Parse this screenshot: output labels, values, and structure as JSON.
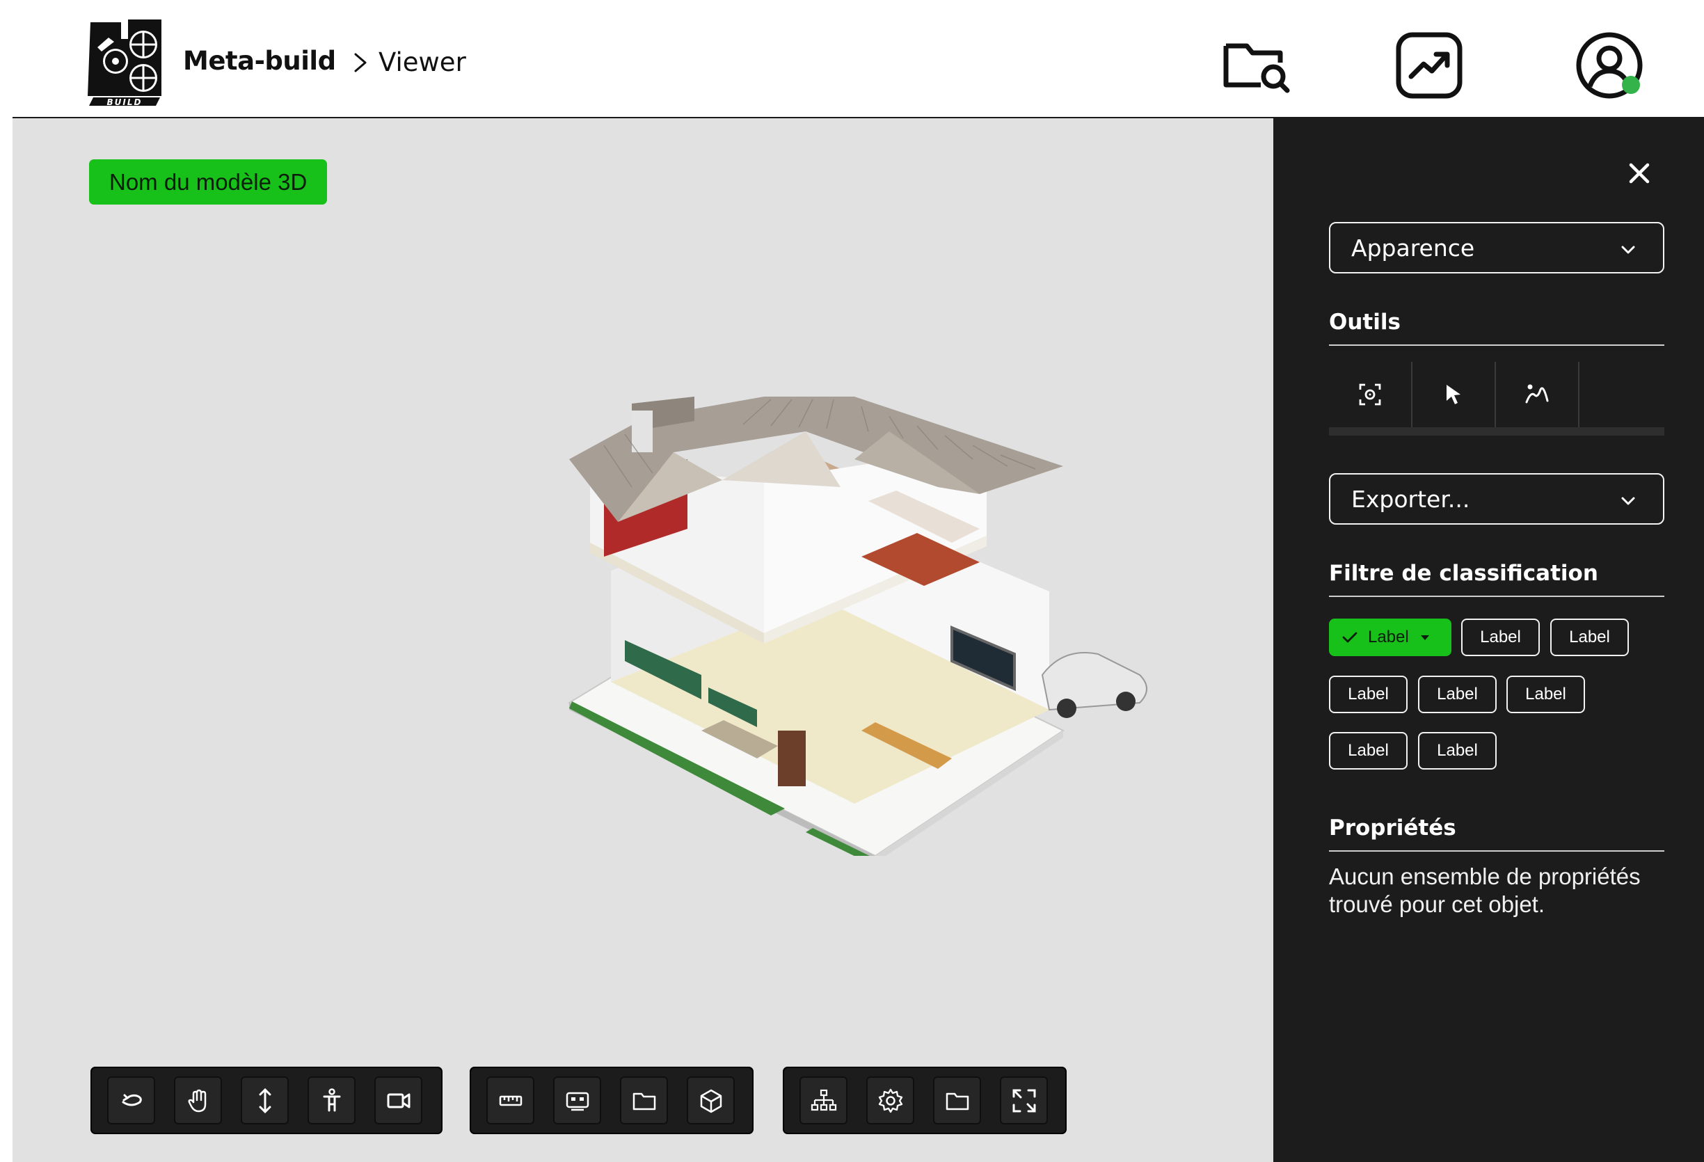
{
  "header": {
    "brand": "Meta-build",
    "breadcrumb": "Viewer",
    "logo_text": "META BUILD",
    "icons": [
      "folder-search-icon",
      "analytics-icon",
      "user-account-icon"
    ],
    "user_status_color": "#33b34a"
  },
  "viewport": {
    "model_name": "Nom du modèle 3D",
    "toolbars": [
      [
        "orbit-icon",
        "pan-hand-icon",
        "vertical-move-icon",
        "first-person-icon",
        "camera-icon"
      ],
      [
        "measure-ruler-icon",
        "section-box-icon",
        "folder-icon",
        "cube-icon"
      ],
      [
        "model-tree-icon",
        "settings-gear-icon",
        "folder-icon",
        "fullscreen-icon"
      ]
    ]
  },
  "panel": {
    "appearance_select": "Apparence",
    "tools_title": "Outils",
    "tools": [
      "focus-target-icon",
      "select-pointer-icon",
      "walk-path-icon"
    ],
    "export_select": "Exporter...",
    "filter_title": "Filtre de classification",
    "chips": [
      {
        "label": "Label",
        "active": true
      },
      {
        "label": "Label",
        "active": false
      },
      {
        "label": "Label",
        "active": false
      },
      {
        "label": "Label",
        "active": false
      },
      {
        "label": "Label",
        "active": false
      },
      {
        "label": "Label",
        "active": false
      },
      {
        "label": "Label",
        "active": false
      },
      {
        "label": "Label",
        "active": false
      }
    ],
    "properties_title": "Propriétés",
    "properties_text": "Aucun ensemble de propriétés trouvé pour cet objet."
  },
  "colors": {
    "accent": "#18c01a",
    "panel_bg": "#1c1c1c",
    "viewport_bg": "#e1e1e1"
  }
}
